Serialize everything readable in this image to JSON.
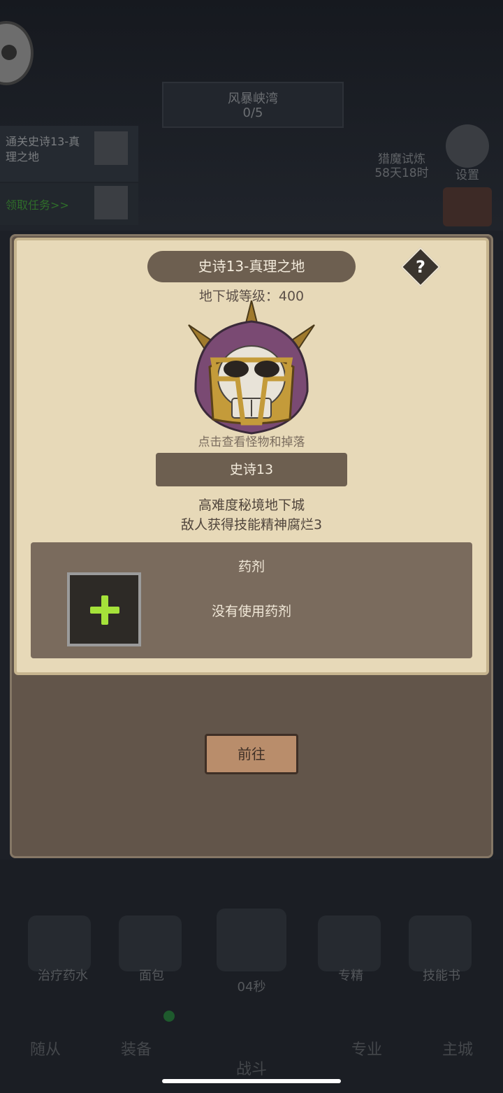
{
  "background": {
    "quest_title": "风暴峡湾",
    "quest_progress": "0/5",
    "task_text": "通关史诗13-真理之地",
    "task2_text": "领取任务>>",
    "hunt_event": "猎魔试炼",
    "hunt_timer": "58天18时",
    "settings_label": "设置",
    "items": [
      {
        "label": "治疗药水"
      },
      {
        "label": "面包"
      },
      {
        "label": "04秒"
      },
      {
        "label": "专精"
      },
      {
        "label": "技能书"
      }
    ],
    "tabs": [
      {
        "label": "随从"
      },
      {
        "label": "装备"
      },
      {
        "label": "战斗"
      },
      {
        "label": "专业"
      },
      {
        "label": "主城"
      }
    ]
  },
  "modal": {
    "title": "史诗13-真理之地",
    "help_symbol": "?",
    "dungeon_level": "地下城等级：400",
    "monster_hint": "点击查看怪物和掉落",
    "difficulty": "史诗13",
    "description_line1": "高难度秘境地下城",
    "description_line2": "敌人获得技能精神腐烂3",
    "potion_title": "药剂",
    "potion_status": "没有使用药剂",
    "go_button": "前往"
  },
  "colors": {
    "panel_bg": "#e7d9b8",
    "dark_pill": "#6d5f50",
    "plus_green": "#a5e23a",
    "button": "#b98d6b"
  }
}
